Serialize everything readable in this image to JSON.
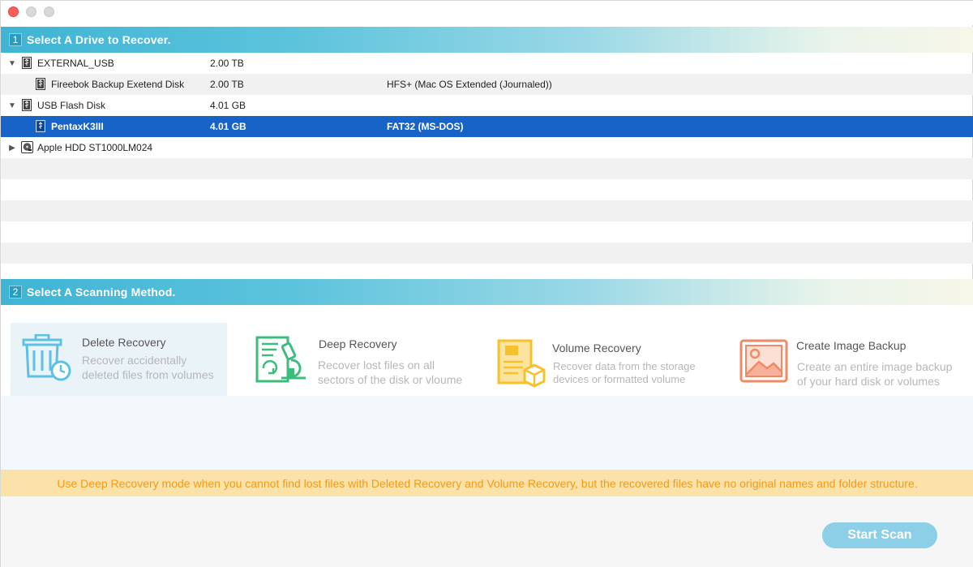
{
  "window": {
    "controls": [
      "close",
      "minimize",
      "maximize"
    ]
  },
  "section1": {
    "number": "1",
    "title": "Select A Drive to Recover."
  },
  "drives": [
    {
      "name": "EXTERNAL_USB",
      "size": "2.00 TB",
      "fs": "",
      "expanded": true,
      "level": 0,
      "icon": "usb-drive-icon"
    },
    {
      "name": "Fireebok Backup Exetend Disk",
      "size": "2.00 TB",
      "fs": "HFS+ (Mac OS Extended (Journaled))",
      "level": 1,
      "icon": "usb-drive-icon"
    },
    {
      "name": "USB Flash Disk",
      "size": "4.01 GB",
      "fs": "",
      "expanded": true,
      "level": 0,
      "icon": "usb-drive-icon"
    },
    {
      "name": "PentaxK3III",
      "size": "4.01 GB",
      "fs": "FAT32 (MS-DOS)",
      "level": 1,
      "selected": true,
      "icon": "usb-drive-icon"
    },
    {
      "name": "Apple HDD ST1000LM024",
      "size": "",
      "fs": "",
      "expanded": false,
      "level": 0,
      "icon": "hard-disk-icon"
    }
  ],
  "section2": {
    "number": "2",
    "title": "Select A Scanning Method."
  },
  "methods": [
    {
      "title": "Delete Recovery",
      "desc1": "Recover accidentally",
      "desc2": "deleted files from volumes",
      "selected": true,
      "icon": "trash-clock-icon",
      "color": "#5fc0e6"
    },
    {
      "title": "Deep Recovery",
      "desc1": "Recover lost files on all",
      "desc2": "sectors of the disk or vloume",
      "icon": "document-microscope-icon",
      "color": "#3dbd7d"
    },
    {
      "title": "Volume Recovery",
      "desc1": "Recover data from the storage",
      "desc2": "devices or formatted volume",
      "icon": "folder-box-icon",
      "color": "#f7c12b"
    },
    {
      "title": "Create Image Backup",
      "desc1": "Create an entire image backup",
      "desc2": "of your hard disk or volumes",
      "icon": "image-icon",
      "color": "#f08a66"
    }
  ],
  "notice": "Use Deep Recovery mode when you cannot find lost files with Deleted Recovery and Volume Recovery, but the recovered files have no original names and folder structure.",
  "start_button": "Start Scan",
  "colors": {
    "header": "#3fb4d4",
    "selection": "#1763c7",
    "notice_bg": "#fbe2a8",
    "notice_text": "#f39a18",
    "button": "#8ccfe6"
  }
}
